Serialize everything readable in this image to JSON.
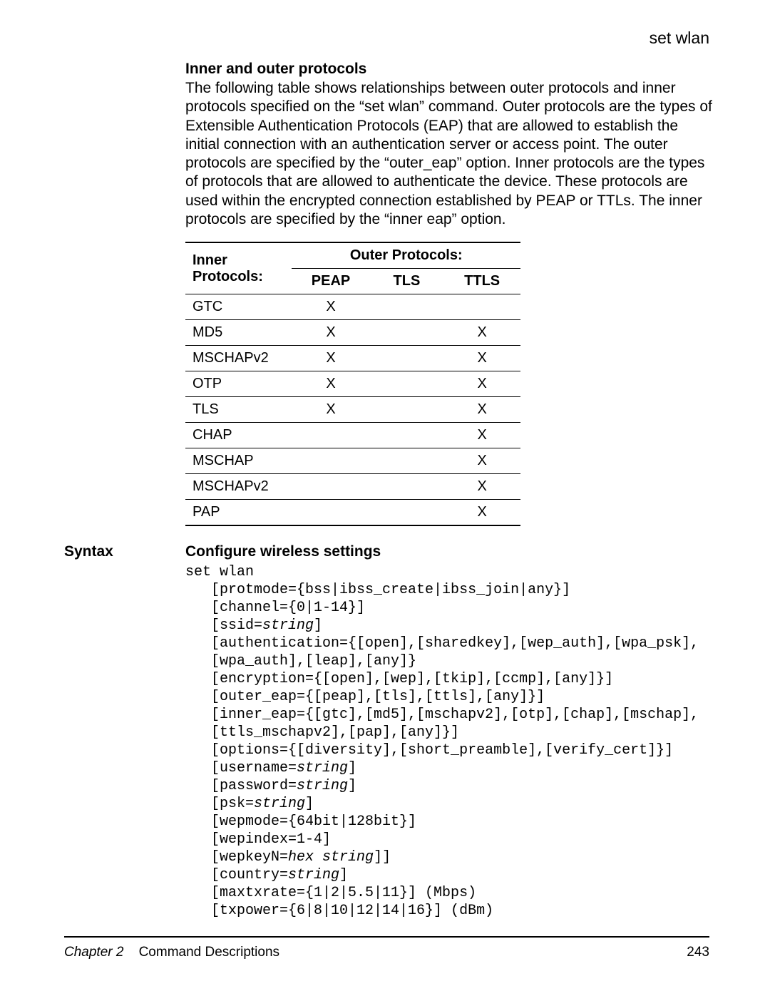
{
  "header": {
    "command": "set wlan"
  },
  "section1": {
    "title": "Inner and outer protocols",
    "paragraph": "The following table shows relationships between outer protocols and inner protocols specified on the “set wlan” command. Outer protocols are the types of Extensible Authentication Protocols (EAP) that are allowed to establish the initial connection with an authentication server or access point. The outer protocols are specified by the “outer_eap” option. Inner protocols are the types of protocols that are allowed to authenticate the device. These protocols are used within the encrypted connection established by PEAP or TTLs. The inner protocols are specified by the “inner eap” option."
  },
  "table": {
    "inner_header": "Inner Protocols:",
    "outer_header": "Outer Protocols:",
    "outer_cols": [
      "PEAP",
      "TLS",
      "TTLS"
    ],
    "rows": [
      {
        "name": "GTC",
        "vals": [
          "X",
          "",
          ""
        ]
      },
      {
        "name": "MD5",
        "vals": [
          "X",
          "",
          "X"
        ]
      },
      {
        "name": "MSCHAPv2",
        "vals": [
          "X",
          "",
          "X"
        ]
      },
      {
        "name": "OTP",
        "vals": [
          "X",
          "",
          "X"
        ]
      },
      {
        "name": "TLS",
        "vals": [
          "X",
          "",
          "X"
        ]
      },
      {
        "name": "CHAP",
        "vals": [
          "",
          "",
          "X"
        ]
      },
      {
        "name": "MSCHAP",
        "vals": [
          "",
          "",
          "X"
        ]
      },
      {
        "name": "MSCHAPv2",
        "vals": [
          "",
          "",
          "X"
        ]
      },
      {
        "name": "PAP",
        "vals": [
          "",
          "",
          "X"
        ]
      }
    ]
  },
  "syntax": {
    "side_label": "Syntax",
    "title": "Configure wireless settings",
    "lines": [
      [
        {
          "t": "set wlan"
        }
      ],
      [
        {
          "t": "   [protmode={bss|ibss_create|ibss_join|any}]"
        }
      ],
      [
        {
          "t": "   [channel={0|1-14}]"
        }
      ],
      [
        {
          "t": "   [ssid="
        },
        {
          "t": "string",
          "i": true
        },
        {
          "t": "]"
        }
      ],
      [
        {
          "t": "   [authentication={[open],[sharedkey],[wep_auth],[wpa_psk],"
        }
      ],
      [
        {
          "t": "   [wpa_auth],[leap],[any]}"
        }
      ],
      [
        {
          "t": "   [encryption={[open],[wep],[tkip],[ccmp],[any]}]"
        }
      ],
      [
        {
          "t": "   [outer_eap={[peap],[tls],[ttls],[any]}]"
        }
      ],
      [
        {
          "t": "   [inner_eap={[gtc],[md5],[mschapv2],[otp],[chap],[mschap],"
        }
      ],
      [
        {
          "t": "   [ttls_mschapv2],[pap],[any]}]"
        }
      ],
      [
        {
          "t": "   [options={[diversity],[short_preamble],[verify_cert]}]"
        }
      ],
      [
        {
          "t": "   [username="
        },
        {
          "t": "string",
          "i": true
        },
        {
          "t": "]"
        }
      ],
      [
        {
          "t": "   [password="
        },
        {
          "t": "string",
          "i": true
        },
        {
          "t": "]"
        }
      ],
      [
        {
          "t": "   [psk="
        },
        {
          "t": "string",
          "i": true
        },
        {
          "t": "]"
        }
      ],
      [
        {
          "t": "   [wepmode={64bit|128bit}]"
        }
      ],
      [
        {
          "t": "   [wepindex=1-4]"
        }
      ],
      [
        {
          "t": "   [wepkeyN="
        },
        {
          "t": "hex string",
          "i": true
        },
        {
          "t": "]]"
        }
      ],
      [
        {
          "t": "   [country="
        },
        {
          "t": "string",
          "i": true
        },
        {
          "t": "]"
        }
      ],
      [
        {
          "t": "   [maxtxrate={1|2|5.5|11}] (Mbps)"
        }
      ],
      [
        {
          "t": "   [txpower={6|8|10|12|14|16}] (dBm)"
        }
      ]
    ]
  },
  "footer": {
    "chapter_label": "Chapter 2",
    "chapter_title": "Command Descriptions",
    "page_number": "243"
  }
}
